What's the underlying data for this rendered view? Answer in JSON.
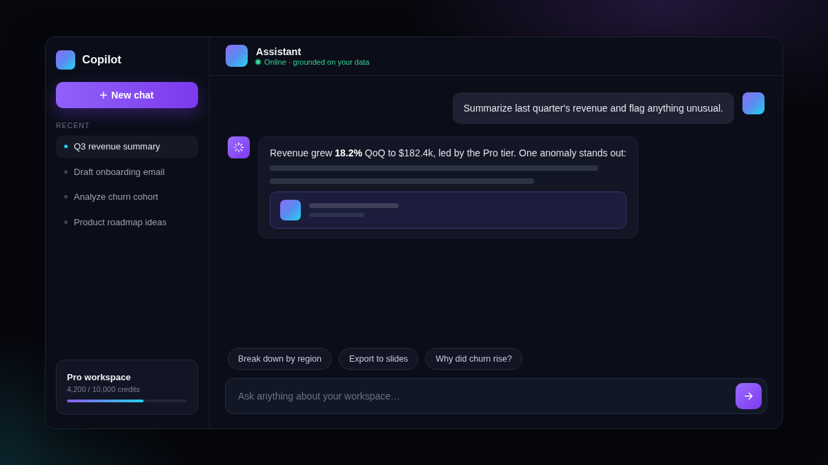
{
  "sidebar": {
    "brand": "Copilot",
    "new_chat": "New chat",
    "section_label": "RECENT",
    "items": [
      {
        "label": "Q3 revenue summary",
        "selected": true
      },
      {
        "label": "Draft onboarding email",
        "selected": false
      },
      {
        "label": "Analyze churn cohort",
        "selected": false
      },
      {
        "label": "Product roadmap ideas",
        "selected": false
      }
    ],
    "plan": {
      "title": "Pro workspace",
      "usage": "4,200 / 10,000 credits",
      "level": 0.64
    }
  },
  "header": {
    "title": "Assistant",
    "status": "Online · grounded on your data",
    "online": true
  },
  "messages": [
    {
      "kind": "user",
      "text": "Summarize last quarter's revenue and flag anything unusual."
    },
    {
      "kind": "assistant",
      "text": "Revenue grew **18.2%** QoQ to $182.4k, led by the Pro tier. One anomaly stands out:",
      "loading": true
    }
  ],
  "suggestions": [
    "Break down by region",
    "Export to slides",
    "Why did churn rise?"
  ],
  "composer": {
    "placeholder": "Ask anything about your workspace…"
  }
}
